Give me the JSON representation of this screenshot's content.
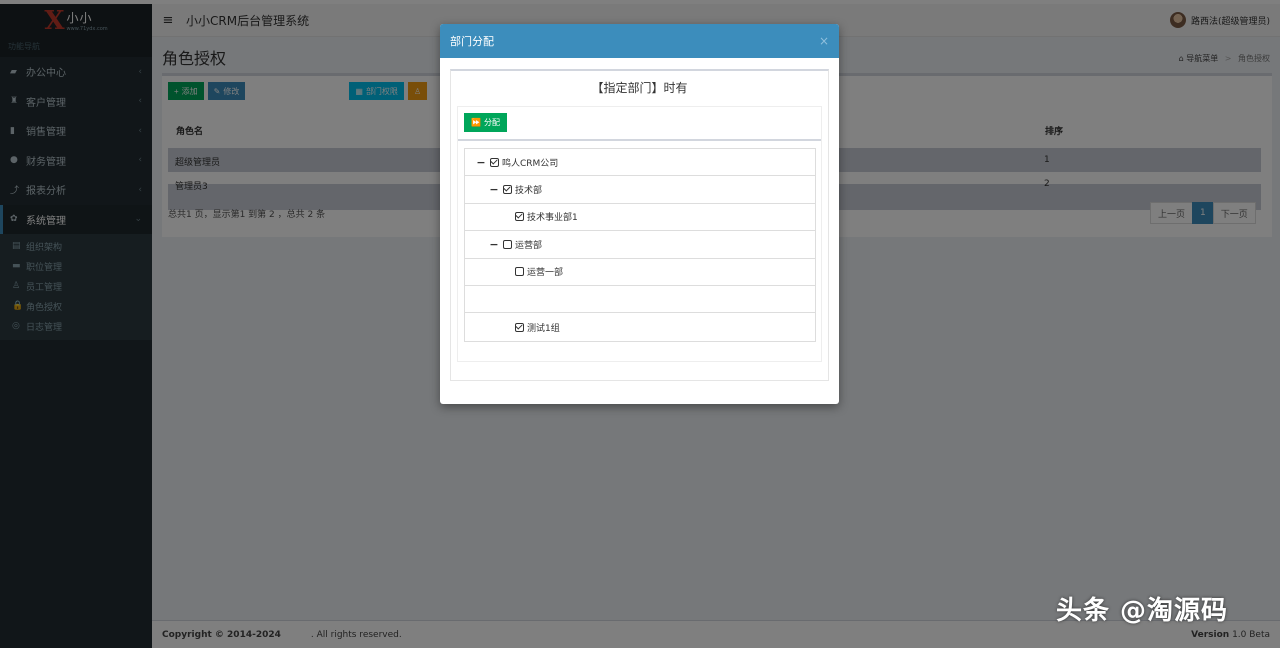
{
  "logo": {
    "cn": "小小",
    "url": "www.71ydx.com"
  },
  "sidebar": {
    "header": "功能导航",
    "items": [
      {
        "label": "办公中心",
        "icon": "▰"
      },
      {
        "label": "客户管理",
        "icon": "♜"
      },
      {
        "label": "销售管理",
        "icon": "▮"
      },
      {
        "label": "财务管理",
        "icon": "●"
      },
      {
        "label": "报表分析",
        "icon": "⤴"
      },
      {
        "label": "系统管理",
        "icon": "✿"
      }
    ],
    "subitems": [
      {
        "label": "组织架构",
        "icon": "▤"
      },
      {
        "label": "职位管理",
        "icon": "▬"
      },
      {
        "label": "员工管理",
        "icon": "♙"
      },
      {
        "label": "角色授权",
        "icon": "🔒"
      },
      {
        "label": "日志管理",
        "icon": "◎"
      }
    ]
  },
  "header": {
    "title": "小小CRM后台管理系统",
    "user": "路西法(超级管理员)"
  },
  "page": {
    "title": "角色授权",
    "breadcrumb": [
      "导航菜单",
      "角色授权"
    ],
    "toolbar": {
      "add": "添加",
      "edit": "修改",
      "dept": "部门权限"
    },
    "table": {
      "headers": {
        "name": "角色名",
        "sort": "排序"
      },
      "rows": [
        {
          "name": "超级管理员",
          "sort": "1"
        },
        {
          "name": "管理员3",
          "sort": "2"
        }
      ],
      "summary": "总共1 页，显示第1 到第 2 ，总共 2 条"
    },
    "pager": {
      "prev": "上一页",
      "current": "1",
      "next": "下一页"
    }
  },
  "footer": {
    "copyright": "Copyright © 2014-2024",
    "rights": ". All rights reserved.",
    "version_label": "Version",
    "version": "1.0 Beta"
  },
  "modal": {
    "title": "部门分配",
    "close": "×",
    "subtitle": "【指定部门】时有",
    "assign": "分配",
    "tree": [
      {
        "label": "鸣人CRM公司",
        "level": 0,
        "toggle": "−",
        "checked": true
      },
      {
        "label": "技术部",
        "level": 1,
        "toggle": "−",
        "checked": true
      },
      {
        "label": "技术事业部1",
        "level": 2,
        "toggle": "",
        "checked": true
      },
      {
        "label": "运营部",
        "level": 1,
        "toggle": "−",
        "checked": false
      },
      {
        "label": "运营一部",
        "level": 2,
        "toggle": "",
        "checked": false
      },
      {
        "label": "",
        "level": 2,
        "toggle": "",
        "checked": null
      },
      {
        "label": "测试1组",
        "level": 2,
        "toggle": "",
        "checked": true
      }
    ]
  },
  "watermark": "头条 @淘源码"
}
